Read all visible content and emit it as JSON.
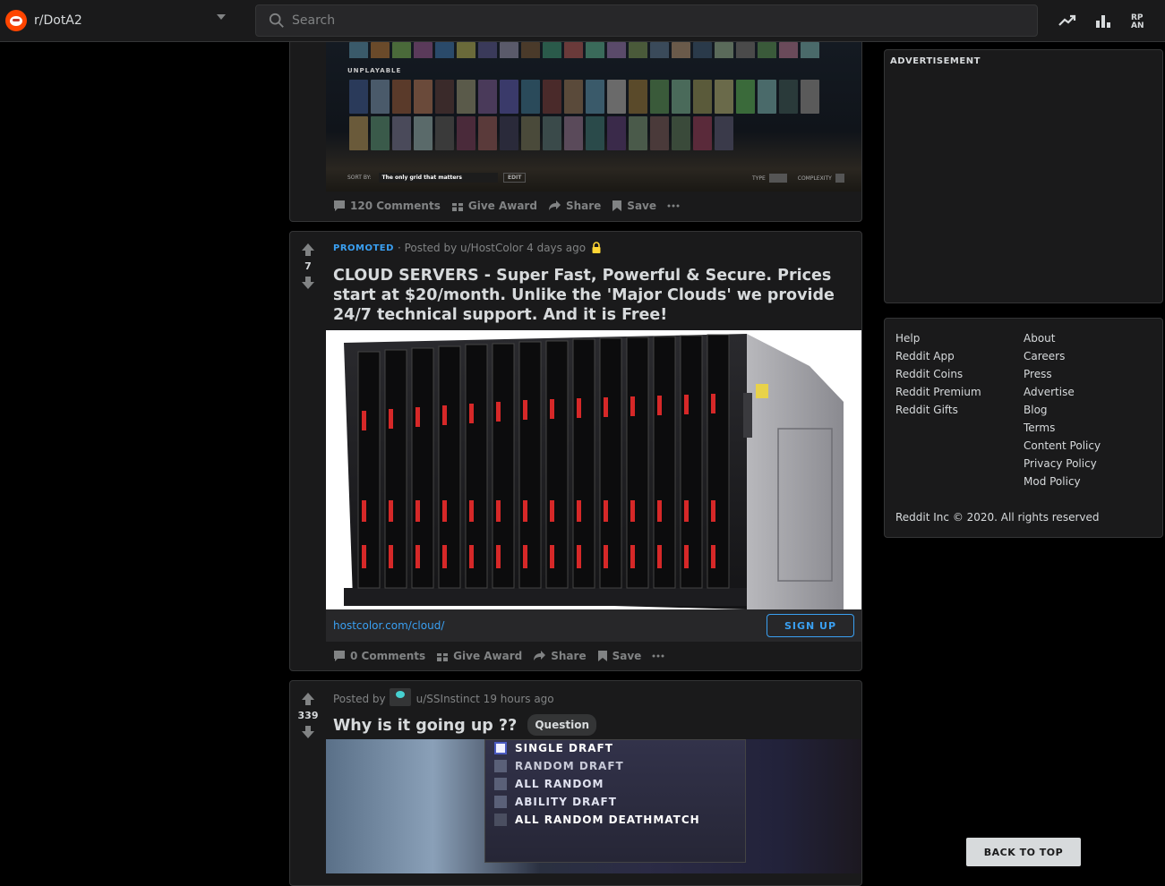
{
  "header": {
    "subreddit": "r/DotA2",
    "search_placeholder": "Search",
    "icons": [
      "trending-icon",
      "leaderboard-icon",
      "rpan-icon"
    ]
  },
  "posts": [
    {
      "heroes_section_label": "UNPLAYABLE",
      "sort_by_label": "SORT BY:",
      "sort_value": "The only grid that matters",
      "edit_label": "EDIT",
      "type_label": "TYPE",
      "complexity_label": "COMPLEXITY",
      "comments": "120 Comments",
      "give_award": "Give Award",
      "share": "Share",
      "save": "Save"
    },
    {
      "score": "7",
      "promoted": "PROMOTED",
      "posted_by": "· Posted by u/HostColor 4 days ago",
      "title": "CLOUD SERVERS - Super Fast, Powerful & Secure. Prices start at $20/month. Unlike the 'Major Clouds' we provide 24/7 technical support. And it is Free!",
      "link": "hostcolor.com/cloud/",
      "cta": "SIGN UP",
      "comments": "0 Comments",
      "give_award": "Give Award",
      "share": "Share",
      "save": "Save"
    },
    {
      "score": "339",
      "posted_by_prefix": "Posted by",
      "posted_by_user": "u/SSInstinct 19 hours ago",
      "title": "Why is it going up ??",
      "flair": "Question",
      "modes": [
        "SINGLE DRAFT",
        "RANDOM DRAFT",
        "ALL RANDOM",
        "ABILITY DRAFT",
        "ALL RANDOM DEATHMATCH"
      ]
    }
  ],
  "sidebar": {
    "ad_label": "ADVERTISEMENT",
    "footer_col1": [
      "Help",
      "Reddit App",
      "Reddit Coins",
      "Reddit Premium",
      "Reddit Gifts"
    ],
    "footer_col2": [
      "About",
      "Careers",
      "Press",
      "Advertise",
      "Blog",
      "Terms",
      "Content Policy",
      "Privacy Policy",
      "Mod Policy"
    ],
    "copyright": "Reddit Inc © 2020. All rights reserved",
    "back_to_top": "BACK TO TOP"
  },
  "colors": {
    "bg": "#000000",
    "card": "#1a1a1b",
    "border": "#343536",
    "text": "#d7dadc",
    "muted": "#818384",
    "accent": "#3aa0f2"
  }
}
